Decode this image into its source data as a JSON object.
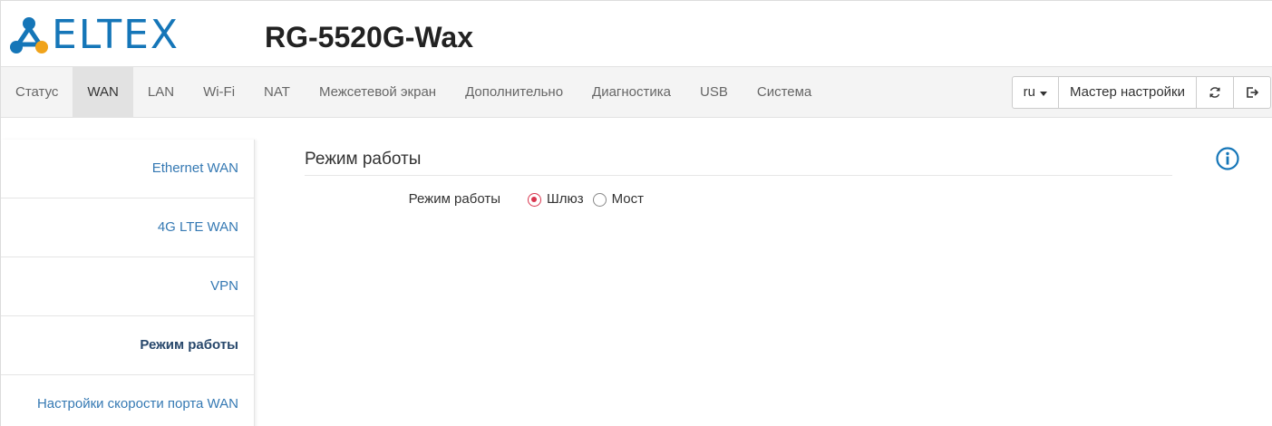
{
  "header": {
    "brand": "ELTEX",
    "model": "RG-5520G-Wax"
  },
  "nav": {
    "items": [
      {
        "label": "Статус",
        "active": false
      },
      {
        "label": "WAN",
        "active": true
      },
      {
        "label": "LAN",
        "active": false
      },
      {
        "label": "Wi-Fi",
        "active": false
      },
      {
        "label": "NAT",
        "active": false
      },
      {
        "label": "Межсетевой экран",
        "active": false
      },
      {
        "label": "Дополнительно",
        "active": false
      },
      {
        "label": "Диагностика",
        "active": false
      },
      {
        "label": "USB",
        "active": false
      },
      {
        "label": "Система",
        "active": false
      }
    ],
    "language": "ru",
    "wizard_label": "Мастер настройки",
    "refresh_icon": "refresh-icon",
    "logout_icon": "logout-icon"
  },
  "sidebar": {
    "items": [
      {
        "label": "Ethernet WAN",
        "active": false
      },
      {
        "label": "4G LTE WAN",
        "active": false
      },
      {
        "label": "VPN",
        "active": false
      },
      {
        "label": "Режим работы",
        "active": true
      },
      {
        "label": "Настройки скорости порта WAN",
        "active": false
      }
    ]
  },
  "main": {
    "section_title": "Режим работы",
    "info_icon": "info-icon",
    "mode_field": {
      "label": "Режим работы",
      "options": [
        {
          "label": "Шлюз",
          "checked": true
        },
        {
          "label": "Мост",
          "checked": false
        }
      ]
    }
  },
  "colors": {
    "brand": "#1576b8",
    "link": "#3579b3",
    "active_link": "#27476b",
    "radio_checked": "#d9364f",
    "nav_bg": "#f4f4f4",
    "nav_active_bg": "#e2e2e2"
  }
}
